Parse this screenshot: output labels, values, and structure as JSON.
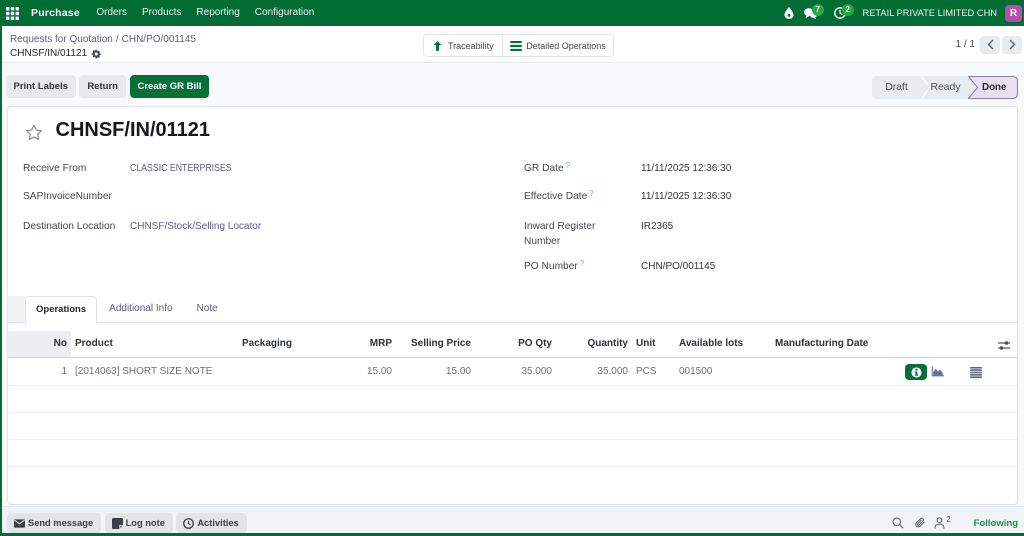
{
  "navbar": {
    "app_name": "Purchase",
    "menus": [
      "Orders",
      "Products",
      "Reporting",
      "Configuration"
    ],
    "message_badge": "7",
    "activity_badge": "2",
    "company": "RETAIL PRIVATE LIMITED CHN",
    "avatar_initial": "R"
  },
  "breadcrumb": {
    "parent1": "Requests for Quotation",
    "separator": "/",
    "parent2": "CHN/PO/001145",
    "current": "CHNSF/IN/01121"
  },
  "stat_buttons": [
    {
      "label": "Traceability"
    },
    {
      "label": "Detailed Operations"
    }
  ],
  "pager": {
    "text": "1 / 1"
  },
  "action_bar": {
    "buttons": [
      {
        "label": "Print Labels"
      },
      {
        "label": "Return"
      },
      {
        "label": "Create GR Bill"
      }
    ],
    "stages": [
      {
        "label": "Draft"
      },
      {
        "label": "Ready"
      },
      {
        "label": "Done"
      }
    ]
  },
  "form": {
    "title": "CHNSF/IN/01121",
    "fields_left": [
      {
        "label": "Receive From",
        "value": "CLASSIC ENTERPRISES"
      },
      {
        "label": "SAPInvoiceNumber",
        "value": ""
      },
      {
        "label": "Destination Location",
        "value": "CHNSF/Stock/Selling Locator"
      }
    ],
    "fields_right": [
      {
        "label": "GR Date",
        "help": "?",
        "value": "11/11/2025 12:36:30"
      },
      {
        "label": "Effective Date",
        "help": "?",
        "value": "11/11/2025 12:36:30"
      },
      {
        "label": "Inward Register Number",
        "help": "",
        "value": "IR2365"
      },
      {
        "label": "PO Number",
        "help": "?",
        "value": "CHN/PO/001145"
      }
    ],
    "tabs": [
      {
        "label": "Operations"
      },
      {
        "label": "Additional Info"
      },
      {
        "label": "Note"
      }
    ],
    "table": {
      "headers": [
        "No",
        "Product",
        "Packaging",
        "MRP",
        "Selling Price",
        "PO Qty",
        "Quantity",
        "Unit",
        "Available lots",
        "Manufacturing Date"
      ],
      "rows": [
        {
          "no": "1",
          "product": "[2014063] SHORT SIZE NOTE",
          "packaging": "",
          "mrp": "15.00",
          "selling_price": "15.00",
          "po_qty": "35.000",
          "quantity": "35.000",
          "unit": "PCS",
          "available_lots": "001500",
          "manufacturing_date": ""
        }
      ]
    }
  },
  "chatter": {
    "send_message": "Send message",
    "log_note": "Log note",
    "activities": "Activities",
    "follower_count": "2",
    "following": "Following"
  }
}
